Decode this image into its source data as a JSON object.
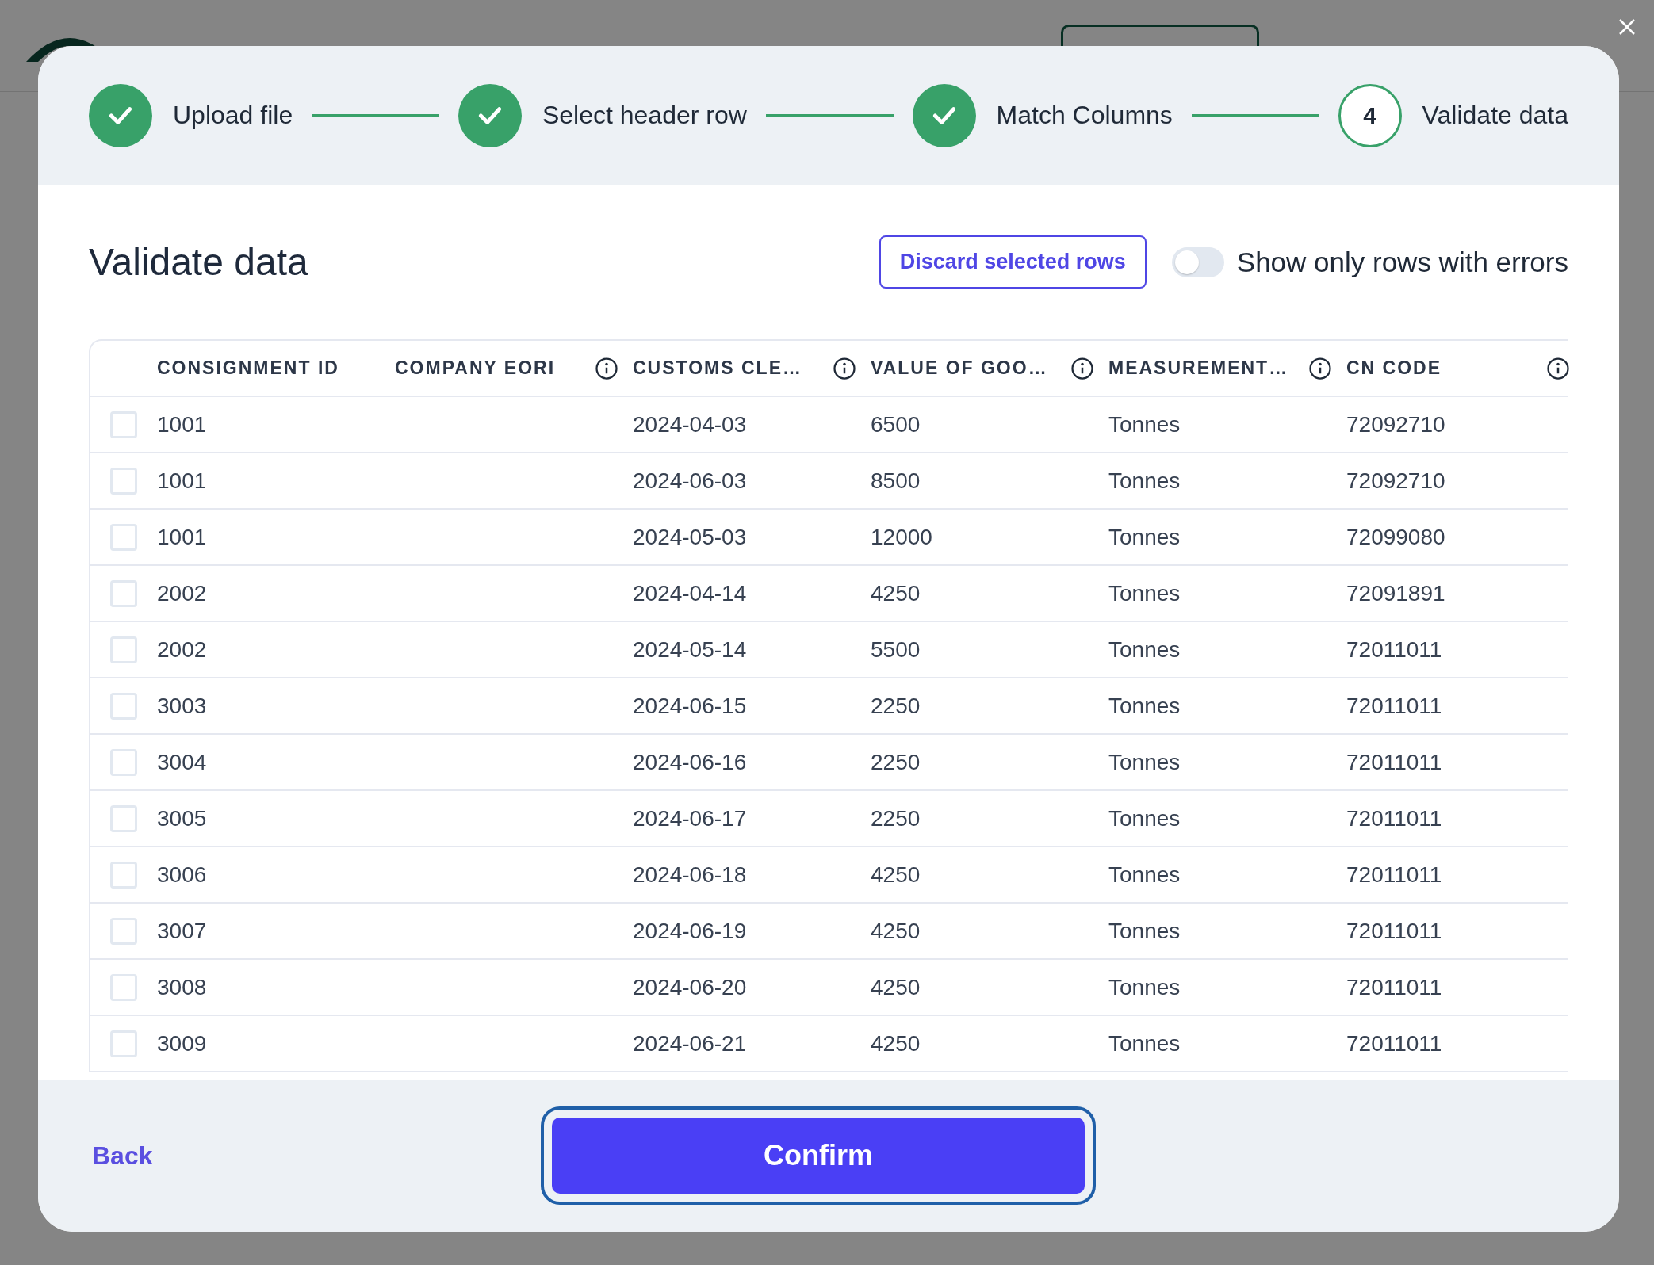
{
  "modal": {
    "steps": [
      {
        "label": "Upload file",
        "completed": true
      },
      {
        "label": "Select header row",
        "completed": true
      },
      {
        "label": "Match Columns",
        "completed": true
      },
      {
        "label": "Validate data",
        "completed": false,
        "number": "4"
      }
    ],
    "title": "Validate data",
    "discard_button": "Discard selected rows",
    "error_toggle": {
      "label": "Show only rows with errors",
      "on": false
    },
    "table": {
      "columns": [
        {
          "label": "CONSIGNMENT ID",
          "info": false
        },
        {
          "label": "COMPANY EORI",
          "info": true
        },
        {
          "label": "CUSTOMS CLE…",
          "info": true
        },
        {
          "label": "VALUE OF GOO…",
          "info": true
        },
        {
          "label": "MEASUREMENT…",
          "info": true
        },
        {
          "label": "CN CODE",
          "info": true
        }
      ],
      "rows": [
        {
          "selected": false,
          "consignment_id": "1001",
          "date": "2024-04-03",
          "value": "6500",
          "unit": "Tonnes",
          "cn_code": "72092710"
        },
        {
          "selected": false,
          "consignment_id": "1001",
          "date": "2024-06-03",
          "value": "8500",
          "unit": "Tonnes",
          "cn_code": "72092710"
        },
        {
          "selected": false,
          "consignment_id": "1001",
          "date": "2024-05-03",
          "value": "12000",
          "unit": "Tonnes",
          "cn_code": "72099080"
        },
        {
          "selected": false,
          "consignment_id": "2002",
          "date": "2024-04-14",
          "value": "4250",
          "unit": "Tonnes",
          "cn_code": "72091891"
        },
        {
          "selected": false,
          "consignment_id": "2002",
          "date": "2024-05-14",
          "value": "5500",
          "unit": "Tonnes",
          "cn_code": "72011011"
        },
        {
          "selected": false,
          "consignment_id": "3003",
          "date": "2024-06-15",
          "value": "2250",
          "unit": "Tonnes",
          "cn_code": "72011011"
        },
        {
          "selected": false,
          "consignment_id": "3004",
          "date": "2024-06-16",
          "value": "2250",
          "unit": "Tonnes",
          "cn_code": "72011011"
        },
        {
          "selected": false,
          "consignment_id": "3005",
          "date": "2024-06-17",
          "value": "2250",
          "unit": "Tonnes",
          "cn_code": "72011011"
        },
        {
          "selected": false,
          "consignment_id": "3006",
          "date": "2024-06-18",
          "value": "4250",
          "unit": "Tonnes",
          "cn_code": "72011011"
        },
        {
          "selected": false,
          "consignment_id": "3007",
          "date": "2024-06-19",
          "value": "4250",
          "unit": "Tonnes",
          "cn_code": "72011011"
        },
        {
          "selected": false,
          "consignment_id": "3008",
          "date": "2024-06-20",
          "value": "4250",
          "unit": "Tonnes",
          "cn_code": "72011011"
        },
        {
          "selected": false,
          "consignment_id": "3009",
          "date": "2024-06-21",
          "value": "4250",
          "unit": "Tonnes",
          "cn_code": "72011011"
        }
      ]
    },
    "back_link": "Back",
    "confirm_button": "Confirm"
  }
}
